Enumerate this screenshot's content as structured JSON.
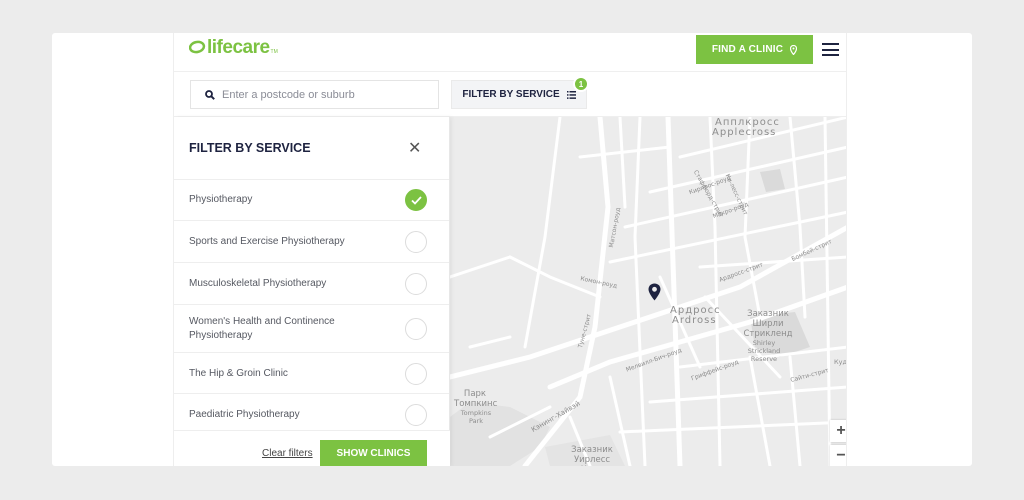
{
  "brand": {
    "logo_text": "lifecare",
    "logo_tm": "TM",
    "color": "#7cc242",
    "icon": "leaf-swoosh-icon"
  },
  "header": {
    "find_clinic_label": "FIND A CLINIC",
    "find_icon": "map-pin-icon",
    "menu_icon": "hamburger-menu-icon"
  },
  "search": {
    "placeholder": "Enter a postcode or suburb",
    "value": "",
    "icon": "search-icon"
  },
  "filter_button": {
    "label": "FILTER BY SERVICE",
    "icon": "list-icon",
    "badge_count": "1"
  },
  "panel": {
    "title": "FILTER BY SERVICE",
    "close_icon": "close-icon",
    "services": [
      {
        "label": "Physiotherapy",
        "checked": true
      },
      {
        "label": "Sports and Exercise Physiotherapy",
        "checked": false
      },
      {
        "label": "Musculoskeletal Physiotherapy",
        "checked": false
      },
      {
        "label": "Women's Health and Continence Physiotherapy",
        "checked": false
      },
      {
        "label": "The Hip & Groin Clinic",
        "checked": false
      },
      {
        "label": "Paediatric Physiotherapy",
        "checked": false
      }
    ],
    "clear_label": "Clear filters",
    "show_label": "SHOW CLINICS"
  },
  "map": {
    "areas": [
      {
        "name": "Апплкросс",
        "name_latin": "Applecross"
      },
      {
        "name": "Ардросс",
        "name_latin": "Ardross"
      },
      {
        "name": "Заказник Ширли Стрикленд",
        "name_latin": "Shirley Strickland Reserve"
      },
      {
        "name": "Парк Томпкинс",
        "name_latin": "Tompkins Park"
      },
      {
        "name": "Заказник Уирлесс Хилл",
        "name_latin": ""
      }
    ],
    "streets": [
      "Матсон-роуд",
      "Комон-роуд",
      "Туне-стрит",
      "Кэнинг-Хайвэй",
      "Мелвилл-Бич-роуд",
      "Стаффорд-стрит",
      "Ардросс-стрит",
      "Ки-лесс-стрит",
      "Гриффейс-роуд",
      "Бомбей-стрит",
      "Кирпрос-роуд",
      "Макро-роуд",
      "Сайти-стрит"
    ],
    "edge_label": "Кудс",
    "marker_icon": "location-marker-icon",
    "zoom_in": "+",
    "zoom_out": "−"
  }
}
